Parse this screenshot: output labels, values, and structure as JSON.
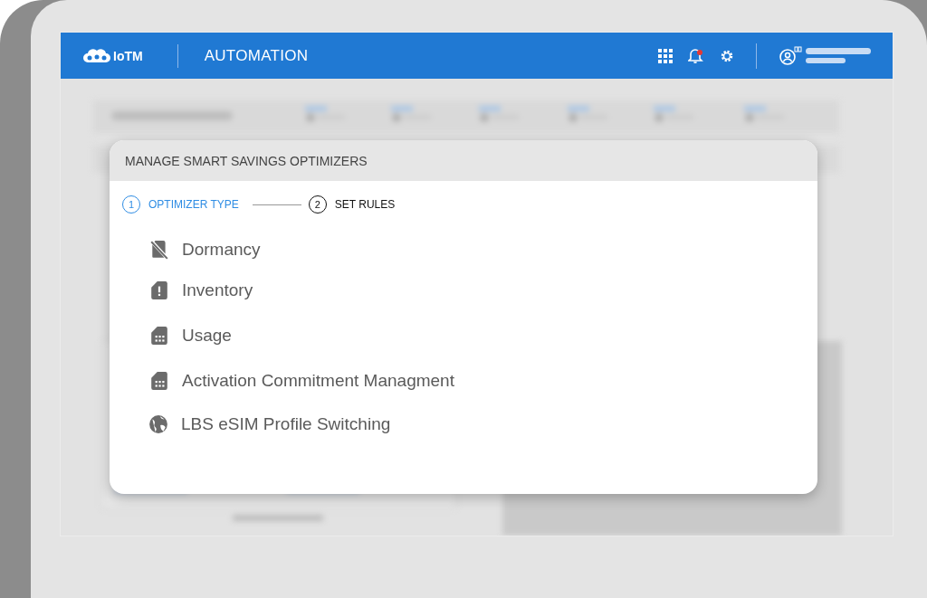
{
  "header": {
    "logo": "IoTM",
    "title": "AUTOMATION"
  },
  "dialog": {
    "title": "MANAGE SMART SAVINGS OPTIMIZERS",
    "steps": [
      {
        "number": "1",
        "label": "OPTIMIZER TYPE",
        "active": true
      },
      {
        "number": "2",
        "label": "SET RULES",
        "active": false
      }
    ],
    "options": [
      {
        "label": "Dormancy"
      },
      {
        "label": "Inventory"
      },
      {
        "label": "Usage"
      },
      {
        "label": "Activation Commitment Managment"
      },
      {
        "label": "LBS eSIM Profile Switching"
      }
    ]
  }
}
